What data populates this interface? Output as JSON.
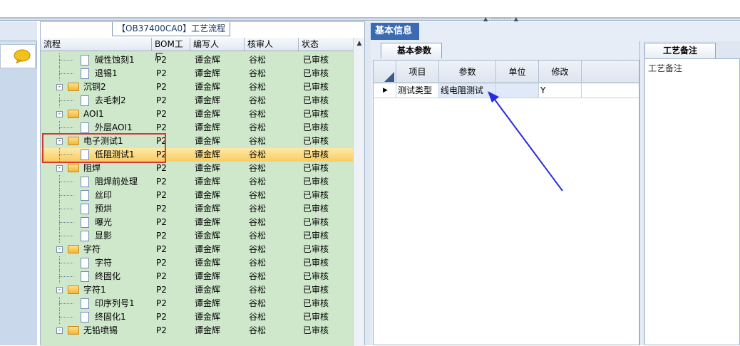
{
  "tree_panel": {
    "title": "【OB37400CA0】工艺流程",
    "columns": [
      "流程",
      "BOM工厂",
      "编写人",
      "核审人",
      "状态"
    ],
    "rows": [
      {
        "label": "碱性蚀刻1",
        "type": "doc",
        "level": 2,
        "bom": "P2",
        "writer": "谭金辉",
        "reviewer": "谷松",
        "status": "已审核"
      },
      {
        "label": "退锡1",
        "type": "doc",
        "level": 2,
        "bom": "P2",
        "writer": "谭金辉",
        "reviewer": "谷松",
        "status": "已审核"
      },
      {
        "label": "沉铜2",
        "type": "folder",
        "level": 1,
        "bom": "P2",
        "writer": "谭金辉",
        "reviewer": "谷松",
        "status": "已审核"
      },
      {
        "label": "去毛刺2",
        "type": "doc",
        "level": 2,
        "bom": "P2",
        "writer": "谭金辉",
        "reviewer": "谷松",
        "status": "已审核"
      },
      {
        "label": "AOI1",
        "type": "folder",
        "level": 1,
        "bom": "P2",
        "writer": "谭金辉",
        "reviewer": "谷松",
        "status": "已审核"
      },
      {
        "label": "外层AOI1",
        "type": "doc",
        "level": 2,
        "bom": "P2",
        "writer": "谭金辉",
        "reviewer": "谷松",
        "status": "已审核"
      },
      {
        "label": "电子测试1",
        "type": "folder",
        "level": 1,
        "bom": "P2",
        "writer": "谭金辉",
        "reviewer": "谷松",
        "status": "已审核"
      },
      {
        "label": "低阻测试1",
        "type": "doc",
        "level": 2,
        "bom": "P2",
        "writer": "谭金辉",
        "reviewer": "谷松",
        "status": "已审核",
        "selected": true
      },
      {
        "label": "阻焊",
        "type": "folder",
        "level": 1,
        "bom": "P2",
        "writer": "谭金辉",
        "reviewer": "谷松",
        "status": "已审核"
      },
      {
        "label": "阻焊前处理",
        "type": "doc",
        "level": 2,
        "bom": "P2",
        "writer": "谭金辉",
        "reviewer": "谷松",
        "status": "已审核"
      },
      {
        "label": "丝印",
        "type": "doc",
        "level": 2,
        "bom": "P2",
        "writer": "谭金辉",
        "reviewer": "谷松",
        "status": "已审核"
      },
      {
        "label": "预烘",
        "type": "doc",
        "level": 2,
        "bom": "P2",
        "writer": "谭金辉",
        "reviewer": "谷松",
        "status": "已审核"
      },
      {
        "label": "曝光",
        "type": "doc",
        "level": 2,
        "bom": "P2",
        "writer": "谭金辉",
        "reviewer": "谷松",
        "status": "已审核"
      },
      {
        "label": "显影",
        "type": "doc",
        "level": 2,
        "bom": "P2",
        "writer": "谭金辉",
        "reviewer": "谷松",
        "status": "已审核"
      },
      {
        "label": "字符",
        "type": "folder",
        "level": 1,
        "bom": "P2",
        "writer": "谭金辉",
        "reviewer": "谷松",
        "status": "已审核"
      },
      {
        "label": "字符",
        "type": "doc",
        "level": 2,
        "bom": "P2",
        "writer": "谭金辉",
        "reviewer": "谷松",
        "status": "已审核"
      },
      {
        "label": "终固化",
        "type": "doc",
        "level": 2,
        "bom": "P2",
        "writer": "谭金辉",
        "reviewer": "谷松",
        "status": "已审核"
      },
      {
        "label": "字符1",
        "type": "folder",
        "level": 1,
        "bom": "P2",
        "writer": "谭金辉",
        "reviewer": "谷松",
        "status": "已审核"
      },
      {
        "label": "印序列号1",
        "type": "doc",
        "level": 2,
        "bom": "P2",
        "writer": "谭金辉",
        "reviewer": "谷松",
        "status": "已审核"
      },
      {
        "label": "终固化1",
        "type": "doc",
        "level": 2,
        "bom": "P2",
        "writer": "谭金辉",
        "reviewer": "谷松",
        "status": "已审核"
      },
      {
        "label": "无铅喷锡",
        "type": "folder",
        "level": 1,
        "bom": "P2",
        "writer": "谭金辉",
        "reviewer": "谷松",
        "status": "已审核"
      }
    ]
  },
  "info_panel": {
    "tab_label": "基本信息",
    "sub_tab_label": "基本参数",
    "columns": [
      "项目",
      "参数",
      "单位",
      "修改"
    ],
    "row": {
      "item": "测试类型",
      "param": "线电阻测试",
      "unit": "",
      "modify": "Y"
    }
  },
  "remark_panel": {
    "tab_label": "工艺备注",
    "field_label": "工艺备注"
  },
  "colors": {
    "tree_bg": "#cfe8cc",
    "selection": "#f8cc62",
    "highlight_box": "#d93636",
    "arrow": "#2a2ae0",
    "tab_active": "#3a6bb3"
  }
}
